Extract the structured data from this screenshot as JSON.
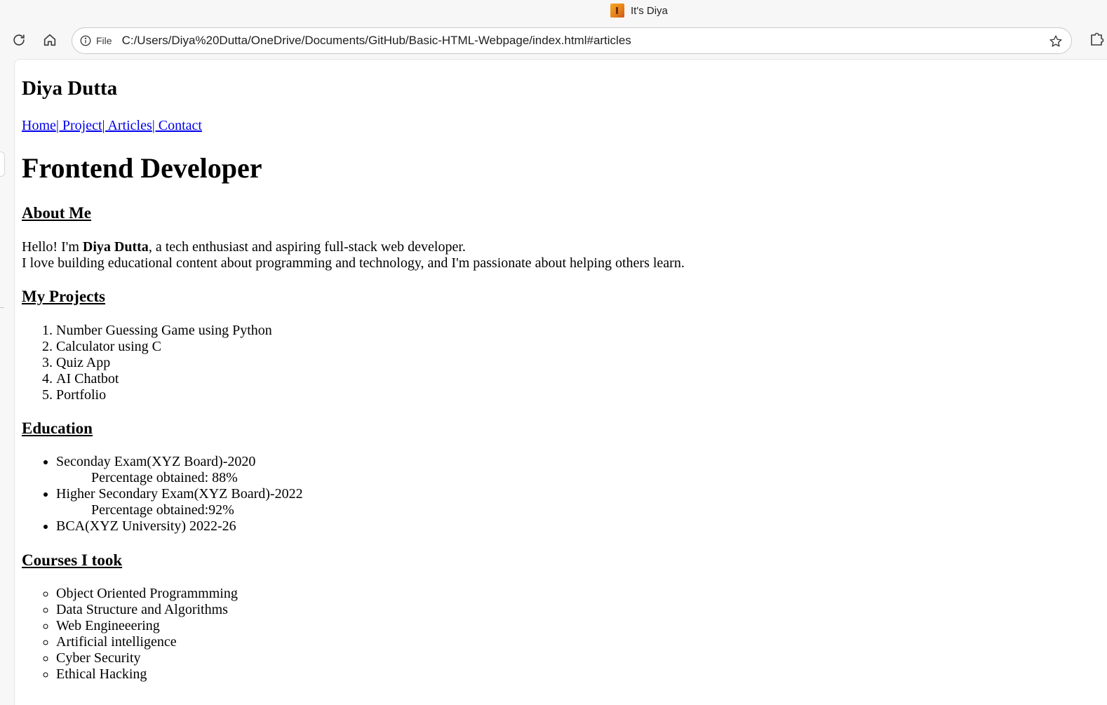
{
  "browser": {
    "tab_title": "It's Diya",
    "site_info_label": "File",
    "url": "C:/Users/Diya%20Dutta/OneDrive/Documents/GitHub/Basic-HTML-Webpage/index.html#articles",
    "icons": [
      "refresh-icon",
      "home-icon",
      "info-icon",
      "star-icon",
      "extensions-icon"
    ]
  },
  "page": {
    "site_name": "Diya Dutta",
    "nav": {
      "home": "Home",
      "project": "| Project",
      "articles": "| Articles",
      "contact": "| Contact"
    },
    "hero": "Frontend Developer",
    "about": {
      "heading": "About Me",
      "intro_before": "Hello! I'm ",
      "intro_name": "Diya Dutta",
      "intro_after": ", a tech enthusiast and aspiring full-stack web developer.",
      "line2": "I love building educational content about programming and technology, and I'm passionate about helping others learn."
    },
    "projects": {
      "heading": "My Projects",
      "items": [
        "Number Guessing Game using Python",
        "Calculator using C",
        "Quiz App",
        "AI Chatbot",
        "Portfolio"
      ]
    },
    "education": {
      "heading": "Education",
      "items": [
        {
          "title": "Seconday Exam(XYZ Board)-2020",
          "detail": "Percentage obtained: 88%"
        },
        {
          "title": "Higher Secondary Exam(XYZ Board)-2022",
          "detail": "Percentage obtained:92%"
        },
        {
          "title": "BCA(XYZ University) 2022-26",
          "detail": ""
        }
      ]
    },
    "courses": {
      "heading": "Courses I took",
      "items": [
        "Object Oriented Programmming",
        "Data Structure and Algorithms",
        "Web Engineeering",
        "Artificial intelligence",
        "Cyber Security",
        "Ethical Hacking"
      ]
    }
  }
}
